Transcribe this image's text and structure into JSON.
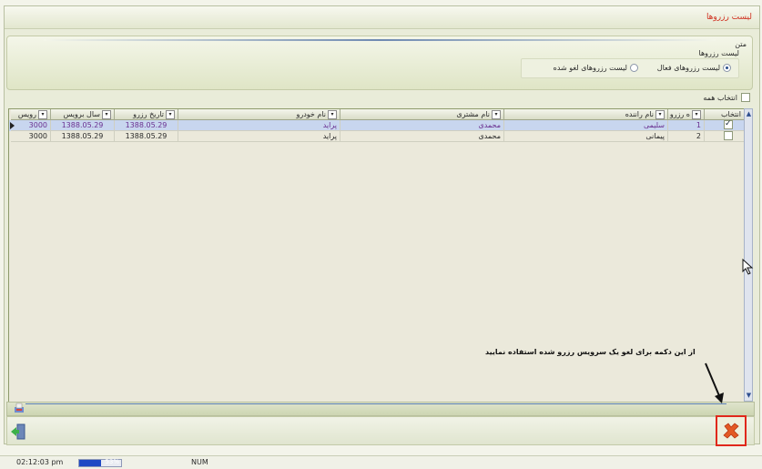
{
  "window": {
    "title": "لیست رزروها"
  },
  "filters": {
    "general_label": "متن",
    "group_label": "لیست رزروها",
    "options": [
      {
        "label": "لیست رزروهای فعال",
        "selected": true
      },
      {
        "label": "لیست رزروهای لغو شده",
        "selected": false
      }
    ],
    "select_all_label": "انتخاب همه"
  },
  "grid": {
    "columns": [
      "انتخاب",
      "ه رزرو",
      "نام راننده",
      "نام مشتری",
      "نام خودرو",
      "تاریخ رزرو",
      "سال برویس",
      "رویس"
    ],
    "rows": [
      {
        "selected": true,
        "checked": true,
        "index": "1",
        "driver": "سلیمی",
        "customer": "محمدی",
        "car": "پراید",
        "reserve_date": "1388.05.29",
        "service_year": "1388.05.29",
        "service": "3000"
      },
      {
        "selected": false,
        "checked": false,
        "index": "2",
        "driver": "پیمانی",
        "customer": "محمدی",
        "car": "پراید",
        "reserve_date": "1388.05.29",
        "service_year": "1388.05.29",
        "service": "3000"
      }
    ]
  },
  "annotation": {
    "note": "از این دکمه برای لغو یک سرویس رزرو شده استفاده نمایید"
  },
  "status": {
    "time": "02:12:03 pm",
    "progress_percent": 53,
    "progress_label": "53%",
    "num": "NUM"
  },
  "icons": {
    "cancel": "red-x-icon",
    "exit": "exit-door-icon",
    "print": "print-icon",
    "cursor": "mouse-cursor-icon"
  },
  "colors": {
    "accent": "#d03020",
    "selection": "#c8d6ef",
    "highlight_border": "#e0281b"
  }
}
